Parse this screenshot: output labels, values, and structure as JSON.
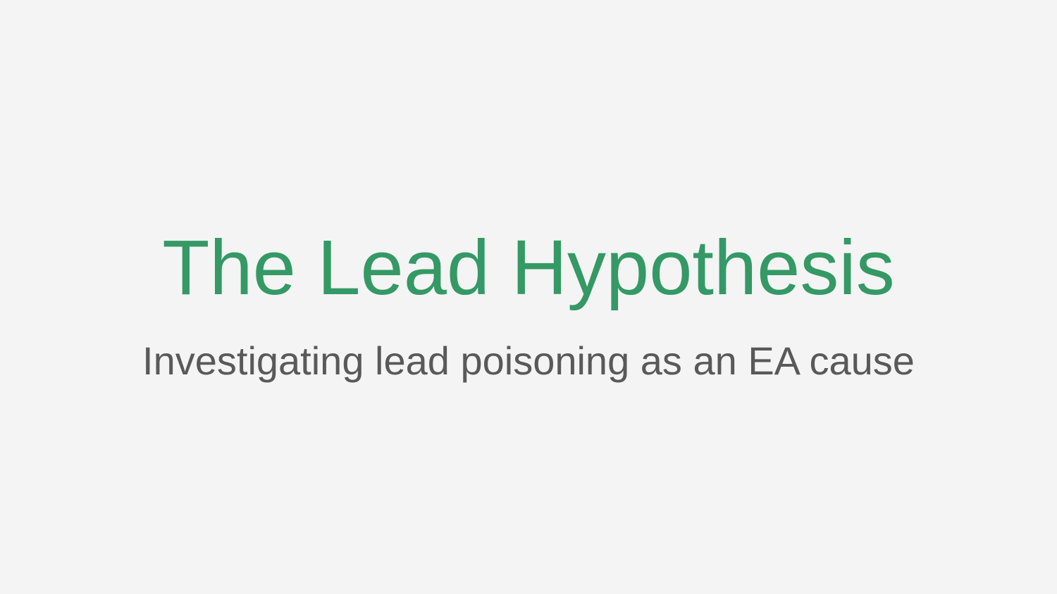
{
  "slide": {
    "title": "The Lead Hypothesis",
    "subtitle": "Investigating lead poisoning as an EA cause"
  },
  "colors": {
    "background": "#f4f4f4",
    "title": "#349965",
    "subtitle": "#595959"
  }
}
